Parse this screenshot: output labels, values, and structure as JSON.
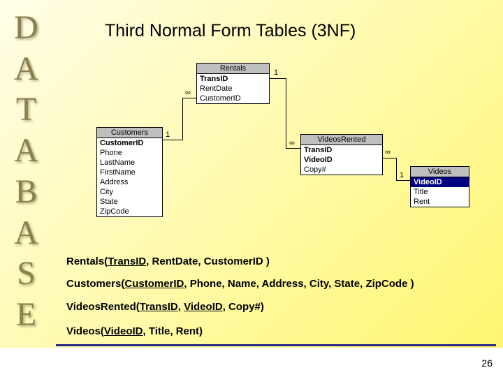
{
  "sidebar": [
    "D",
    "A",
    "T",
    "A",
    "B",
    "A",
    "S",
    "E"
  ],
  "title": "Third Normal Form Tables (3NF)",
  "tables": {
    "rentals": {
      "name": "Rentals",
      "fields": [
        "TransID",
        "RentDate",
        "CustomerID"
      ],
      "pk": [
        0
      ]
    },
    "customers": {
      "name": "Customers",
      "fields": [
        "CustomerID",
        "Phone",
        "LastName",
        "FirstName",
        "Address",
        "City",
        "State",
        "ZipCode"
      ],
      "pk": [
        0
      ]
    },
    "videosrented": {
      "name": "VideosRented",
      "fields": [
        "TransID",
        "VideoID",
        "Copy#"
      ],
      "pk": [
        0,
        1
      ]
    },
    "videos": {
      "name": "Videos",
      "fields": [
        "VideoID",
        "Title",
        "Rent"
      ],
      "pk": [
        0
      ],
      "sel": [
        0
      ]
    }
  },
  "rel": {
    "inf": "∞",
    "one": "1"
  },
  "notations": {
    "n1": {
      "t": "Rentals(",
      "u": "TransID",
      "r": ", RentDate, CustomerID )"
    },
    "n2": {
      "t": "Customers(",
      "u": "CustomerID",
      "r": ", Phone, Name, Address, City, State, ZipCode )"
    },
    "n3": {
      "t": "VideosRented(",
      "u1": "TransID",
      "m": ", ",
      "u2": "VideoID",
      "r": ", Copy#)"
    },
    "n4": {
      "t": "Videos(",
      "u": "VideoID",
      "r": ", Title, Rent)"
    }
  },
  "page": "26"
}
